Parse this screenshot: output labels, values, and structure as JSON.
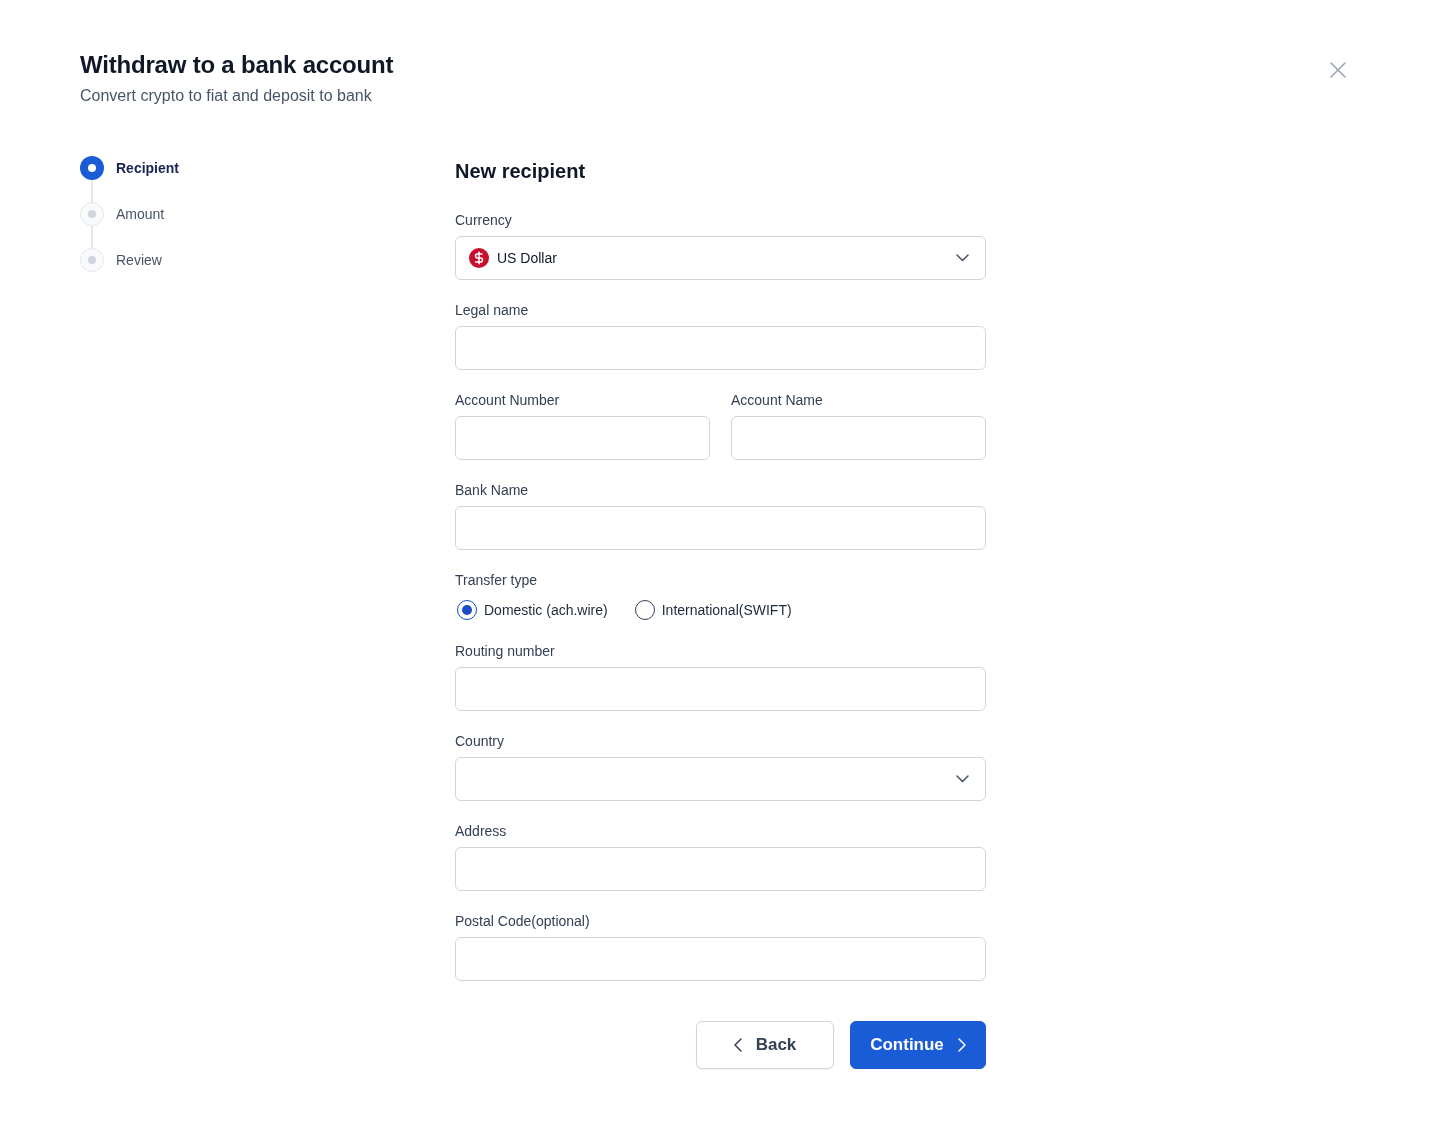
{
  "header": {
    "title": "Withdraw to a bank account",
    "subtitle": "Convert crypto to fiat and deposit to bank"
  },
  "steps": [
    {
      "label": "Recipient",
      "selected": true
    },
    {
      "label": "Amount",
      "selected": false
    },
    {
      "label": "Review",
      "selected": false
    }
  ],
  "form": {
    "title": "New recipient",
    "fields": [
      {
        "kind": "select",
        "label": "Currency",
        "value": "US Dollar"
      },
      {
        "kind": "text",
        "label": "Legal name"
      },
      {
        "kind": "pair",
        "items": [
          {
            "label": "Account Number"
          },
          {
            "label": "Account Name"
          }
        ]
      },
      {
        "kind": "text",
        "label": "Bank Name"
      },
      {
        "kind": "radio",
        "label": "Transfer type",
        "options": [
          {
            "label": "Domestic (ach.wire)",
            "selected": true
          },
          {
            "label": "International(SWIFT)",
            "selected": false
          }
        ]
      },
      {
        "kind": "text",
        "label": "Routing number"
      },
      {
        "kind": "select",
        "label": "Country"
      },
      {
        "kind": "text",
        "label": "Address"
      },
      {
        "kind": "text",
        "label": "Postal Code(optional)"
      }
    ]
  },
  "buttons": [
    {
      "kind": "secondary",
      "label": "Back"
    },
    {
      "kind": "primary",
      "label": "Continue"
    }
  ]
}
